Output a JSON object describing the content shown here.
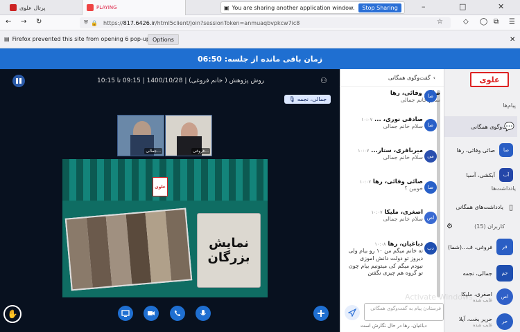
{
  "browser": {
    "tabs": [
      {
        "label": "پرتال علوی"
      },
      {
        "label": "PLAYING"
      }
    ],
    "share_notice": "You are sharing another application window.",
    "stop_sharing_label": "Stop Sharing",
    "url_prefix": "https://",
    "url_host": "817.6426.ir",
    "url_path": "/html5client/join?sessionToken=anmuaqbvpkcw7ic8",
    "popup_notice": "Firefox prevented this site from opening 6 pop-up windows.",
    "options_label": "Options"
  },
  "timer": {
    "label": "زمان باقی مانده از جلسه: 06:50"
  },
  "main": {
    "session_title": "روش پژوهش ( خانم فروغی) | 1400/10/28 | 09:15 تا 10:15",
    "presenter": "جمالی، نجمه",
    "cams": [
      {
        "label": "جمالی..."
      },
      {
        "label": "فروغی..."
      }
    ],
    "slide": {
      "title_line1": "نمایش",
      "title_line2": "بزرگان",
      "logo_text": "علوی"
    }
  },
  "chat": {
    "header": "گفت‌وگوی همگانی",
    "messages": [
      {
        "avatar": "صا",
        "name": "صادقی نوری، ...",
        "time": "۱۰:۰۷",
        "body": "سلام خانم جمالی"
      },
      {
        "avatar": "می",
        "name": "میربافری، ستار...",
        "time": "۱۰:۰۷",
        "body": "سلام خانم جمالی"
      },
      {
        "avatar": "صا",
        "name": "صائی وفائی، رها",
        "time": "۱۰:۰۷",
        "body": "خوبین ؟"
      },
      {
        "avatar": "اص",
        "name": "اصغری، ملیکا",
        "time": "۱۰:۰۷",
        "body": "سلام خانم جمالی"
      },
      {
        "avatar": "دب",
        "name": "دباغیان، رها",
        "time": "۱۰:۰۸",
        "body": "ته خانم میگم من ۱۰ رو بیام ولی دیروز تو دولت دانش اموزی نبودم میگم کی میتونیم بیام چون تو گروه هم چیزی نگفتن"
      }
    ],
    "top_partial": {
      "name": "صائی وفائی، رها",
      "body": "سلام خانم جمالی"
    },
    "input_placeholder": "فرستادن پیام به گفت‌وگوی همگانی",
    "typing": "دباغیان، رها در حال نگارش است"
  },
  "sidebar": {
    "logo": "علوی",
    "messages_title": "پیام‌ها",
    "public_chat": "گفت‌وگوی همگانی",
    "private_chats": [
      {
        "avatar": "صا",
        "name": "صائی وفائی، رها"
      },
      {
        "avatar": "آب",
        "name": "آبکشی، آسیا"
      }
    ],
    "notes_title": "یادداشت‌ها",
    "shared_notes": "یادداشت‌های همگانی",
    "users_title": "کاربران (15)",
    "users": [
      {
        "avatar": "فر",
        "name": "فروغی، ف...(شما)",
        "sub": ""
      },
      {
        "avatar": "جم",
        "name": "جمالی، نجمه",
        "sub": ""
      },
      {
        "avatar": "اص",
        "name": "اصغری، ملیکا",
        "sub": "غایب شده"
      },
      {
        "avatar": "حر",
        "name": "حریر بخت، آیلا",
        "sub": "غایب شده"
      }
    ]
  },
  "watermark": "Activate Windows",
  "colors": {
    "primary": "#1f6fd1",
    "main_bg": "#08111f",
    "slide_bg": "#0f6d63",
    "logo_red": "#dd2222"
  }
}
